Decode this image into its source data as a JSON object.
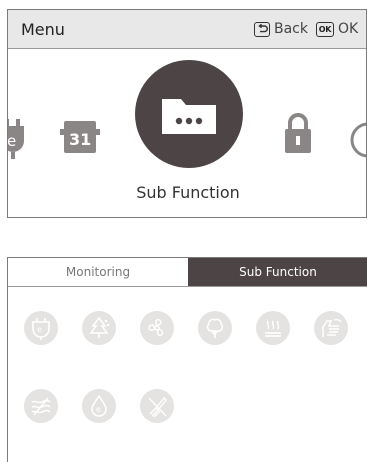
{
  "menu": {
    "title": "Menu",
    "back_label": "Back",
    "ok_label": "OK",
    "ok_key": "OK",
    "selected_label": "Sub Function",
    "calendar_day": "31",
    "energy_letter": "e",
    "carousel_icons": [
      "energy-plug-icon",
      "calendar-icon",
      "folder-icon",
      "lock-icon",
      "timer-icon"
    ]
  },
  "subfunction": {
    "tabs": [
      {
        "label": "Monitoring",
        "active": false
      },
      {
        "label": "Sub Function",
        "active": true
      }
    ],
    "icons": [
      "energy-plug-icon",
      "tree-icon",
      "fan-icon",
      "plant-icon",
      "heater-icon",
      "hand-airflow-icon",
      "anti-allergy-icon",
      "water-drop-icon",
      "brush-clean-icon"
    ],
    "drop_letter": "e"
  },
  "colors": {
    "selected_circle": "#4d4545",
    "tab_active": "#4d4545",
    "icon_bg": "#e5e3e1",
    "icon_stroke": "#ffffff",
    "header_bg": "#e8e8e8"
  }
}
